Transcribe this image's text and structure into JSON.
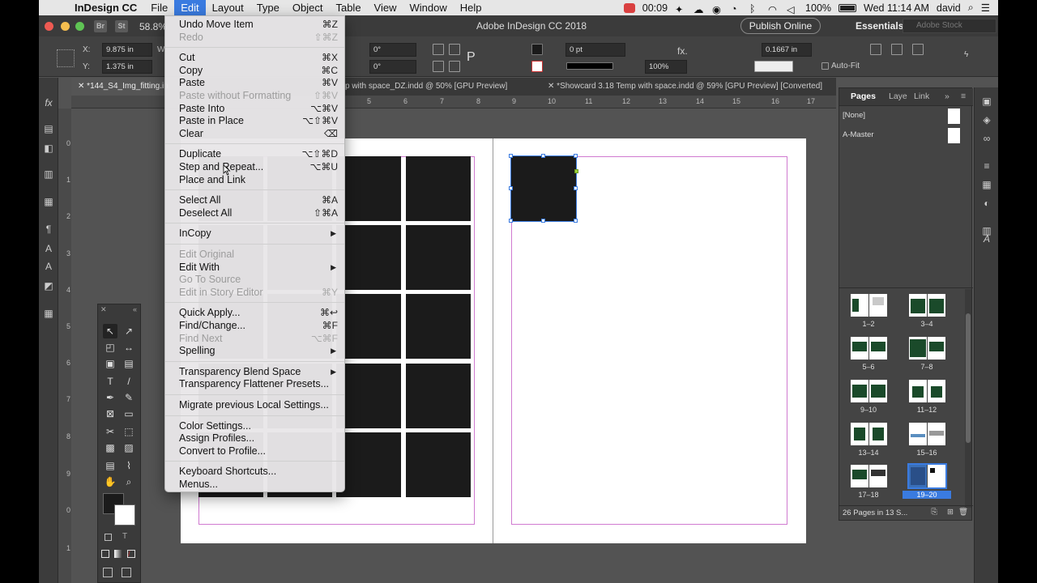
{
  "menubar": {
    "app_name": "InDesign CC",
    "items": [
      "File",
      "Edit",
      "Layout",
      "Type",
      "Object",
      "Table",
      "View",
      "Window",
      "Help"
    ],
    "active": "Edit",
    "timer": "00:09",
    "battery": "100%",
    "clock": "Wed 11:14 AM",
    "user": "david"
  },
  "titlebar": {
    "zoom": "58.8%",
    "title": "Adobe InDesign CC 2018",
    "publish_label": "Publish Online",
    "workspace": "Essentials",
    "stock_placeholder": "Adobe Stock",
    "app_buttons": [
      "Br",
      "St"
    ]
  },
  "control": {
    "x_label": "X:",
    "x_value": "9.875 in",
    "y_label": "Y:",
    "y_value": "1.375 in",
    "w_label": "W:",
    "angle1": "0°",
    "angle2": "0°",
    "stroke": "0 pt",
    "opacity": "100%",
    "offset": "0.1667 in",
    "autofit_label": "Auto-Fit"
  },
  "tabs": [
    {
      "label": "*144_S4_Img_fitting.in",
      "active": true
    },
    {
      "label": "p with space_DZ.indd @ 50% [GPU Preview]",
      "active": false
    },
    {
      "label": "*Showcard 3.18 Temp with space.indd @ 59% [GPU Preview] [Converted]",
      "active": false
    }
  ],
  "ruler": {
    "h_ticks": [
      "5",
      "6",
      "7",
      "8",
      "9",
      "10",
      "11",
      "12",
      "13",
      "14",
      "15",
      "16",
      "17"
    ],
    "v_ticks": [
      "0",
      "1",
      "2",
      "3",
      "4",
      "5",
      "6",
      "7",
      "8",
      "9",
      "0",
      "1"
    ]
  },
  "edit_menu": {
    "items": [
      {
        "label": "Undo Move Item",
        "shortcut": "⌘Z",
        "enabled": true
      },
      {
        "label": "Redo",
        "shortcut": "⇧⌘Z",
        "enabled": false
      },
      {
        "label": "Cut",
        "shortcut": "⌘X",
        "enabled": true
      },
      {
        "label": "Copy",
        "shortcut": "⌘C",
        "enabled": true
      },
      {
        "label": "Paste",
        "shortcut": "⌘V",
        "enabled": true
      },
      {
        "label": "Paste without Formatting",
        "shortcut": "⇧⌘V",
        "enabled": false
      },
      {
        "label": "Paste Into",
        "shortcut": "⌥⌘V",
        "enabled": true
      },
      {
        "label": "Paste in Place",
        "shortcut": "⌥⇧⌘V",
        "enabled": true
      },
      {
        "label": "Clear",
        "shortcut": "⌫",
        "enabled": true
      },
      {
        "label": "Duplicate",
        "shortcut": "⌥⇧⌘D",
        "enabled": true
      },
      {
        "label": "Step and Repeat...",
        "shortcut": "⌥⌘U",
        "enabled": true
      },
      {
        "label": "Place and Link",
        "shortcut": "",
        "enabled": true
      },
      {
        "label": "Select All",
        "shortcut": "⌘A",
        "enabled": true
      },
      {
        "label": "Deselect All",
        "shortcut": "⇧⌘A",
        "enabled": true
      },
      {
        "label": "InCopy",
        "shortcut": "",
        "enabled": true,
        "submenu": true
      },
      {
        "label": "Edit Original",
        "shortcut": "",
        "enabled": false
      },
      {
        "label": "Edit With",
        "shortcut": "",
        "enabled": true,
        "submenu": true
      },
      {
        "label": "Go To Source",
        "shortcut": "",
        "enabled": false
      },
      {
        "label": "Edit in Story Editor",
        "shortcut": "⌘Y",
        "enabled": false
      },
      {
        "label": "Quick Apply...",
        "shortcut": "⌘↩",
        "enabled": true
      },
      {
        "label": "Find/Change...",
        "shortcut": "⌘F",
        "enabled": true
      },
      {
        "label": "Find Next",
        "shortcut": "⌥⌘F",
        "enabled": false
      },
      {
        "label": "Spelling",
        "shortcut": "",
        "enabled": true,
        "submenu": true
      },
      {
        "label": "Transparency Blend Space",
        "shortcut": "",
        "enabled": true,
        "submenu": true
      },
      {
        "label": "Transparency Flattener Presets...",
        "shortcut": "",
        "enabled": true
      },
      {
        "label": "Migrate previous Local Settings...",
        "shortcut": "",
        "enabled": true
      },
      {
        "label": "Color Settings...",
        "shortcut": "",
        "enabled": true
      },
      {
        "label": "Assign Profiles...",
        "shortcut": "",
        "enabled": true
      },
      {
        "label": "Convert to Profile...",
        "shortcut": "",
        "enabled": true
      },
      {
        "label": "Keyboard Shortcuts...",
        "shortcut": "",
        "enabled": true
      },
      {
        "label": "Menus...",
        "shortcut": "",
        "enabled": true
      }
    ]
  },
  "pages_panel": {
    "tabs": [
      "Pages",
      "Laye",
      "Link"
    ],
    "masters": [
      "[None]",
      "A-Master"
    ],
    "spreads": [
      "1–2",
      "3–4",
      "5–6",
      "7–8",
      "9–10",
      "11–12",
      "13–14",
      "15–16",
      "17–18",
      "19–20"
    ],
    "selected_spread": "19–20",
    "footer": "26 Pages in 13 S..."
  },
  "colors": {
    "menu_highlight": "#3a7be0",
    "margin_guide": "#d07ad0",
    "frame_fill": "#1b1b1b"
  }
}
